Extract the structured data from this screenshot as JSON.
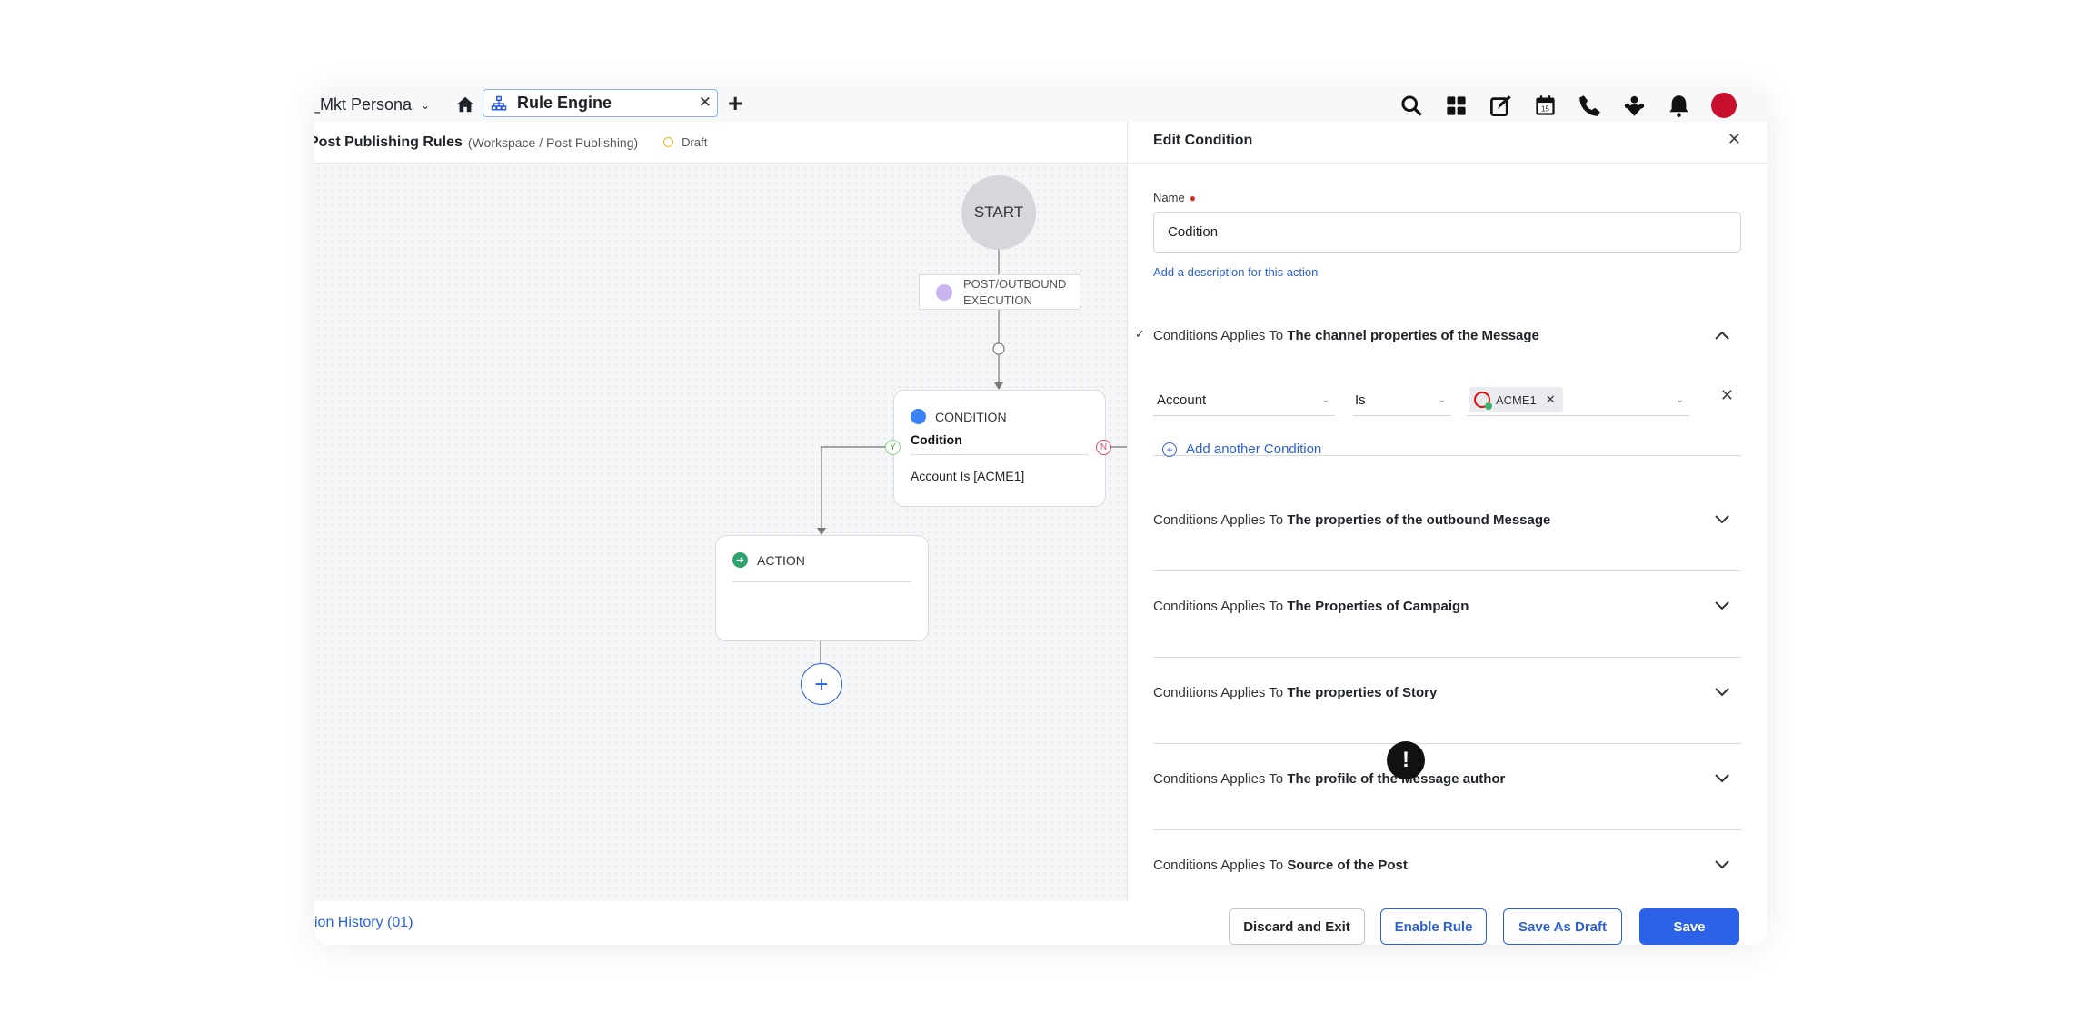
{
  "topbar": {
    "persona_label": "_Mkt Persona",
    "tab_label": "Rule Engine",
    "icons": [
      "home-icon",
      "rule-engine-icon",
      "close-icon",
      "add-tab-icon",
      "search-icon",
      "apps-grid-icon",
      "compose-icon",
      "calendar-icon",
      "phone-icon",
      "community-icon",
      "bell-icon",
      "avatar"
    ],
    "calendar_day": "15"
  },
  "subheader": {
    "title": "Post Publishing Rules",
    "path": "(Workspace / Post Publishing)",
    "status": "Draft"
  },
  "canvas": {
    "start_label": "START",
    "trigger_label": "POST/OUTBOUND EXECUTION",
    "condition_node": {
      "type_label": "CONDITION",
      "name": "Codition",
      "expression": "Account Is [ACME1]",
      "yes_badge": "Y",
      "no_badge": "N"
    },
    "action_node": {
      "type_label": "ACTION"
    },
    "add_node_label": "+"
  },
  "footer_left": {
    "history_link": "ion History (01)"
  },
  "panel": {
    "title": "Edit Condition",
    "name_label": "Name",
    "name_value": "Codition",
    "description_link": "Add a description for this action",
    "sections": [
      {
        "prefix": "Conditions Applies To",
        "target": "The channel properties of the Message",
        "expanded": true
      },
      {
        "prefix": "Conditions Applies To",
        "target": "The properties of the outbound Message",
        "expanded": false
      },
      {
        "prefix": "Conditions Applies To",
        "target": "The Properties of Campaign",
        "expanded": false
      },
      {
        "prefix": "Conditions Applies To",
        "target": "The properties of Story",
        "expanded": false
      },
      {
        "prefix": "Conditions Applies To",
        "target": "The profile of the Message author",
        "expanded": false
      },
      {
        "prefix": "Conditions Applies To",
        "target": "Source of the Post",
        "expanded": false
      }
    ],
    "condition_row": {
      "field": "Account",
      "operator": "Is",
      "value_chip": "ACME1"
    },
    "add_condition_label": "Add another Condition"
  },
  "footer_right": {
    "discard_label": "Discard and Exit",
    "enable_label": "Enable Rule",
    "draft_label": "Save As Draft",
    "save_label": "Save"
  },
  "colors": {
    "accent": "#2b62e8",
    "link": "#2b5fd9",
    "draft_dot": "#f0b429",
    "yes": "#4caf50",
    "no": "#e04a6a"
  }
}
